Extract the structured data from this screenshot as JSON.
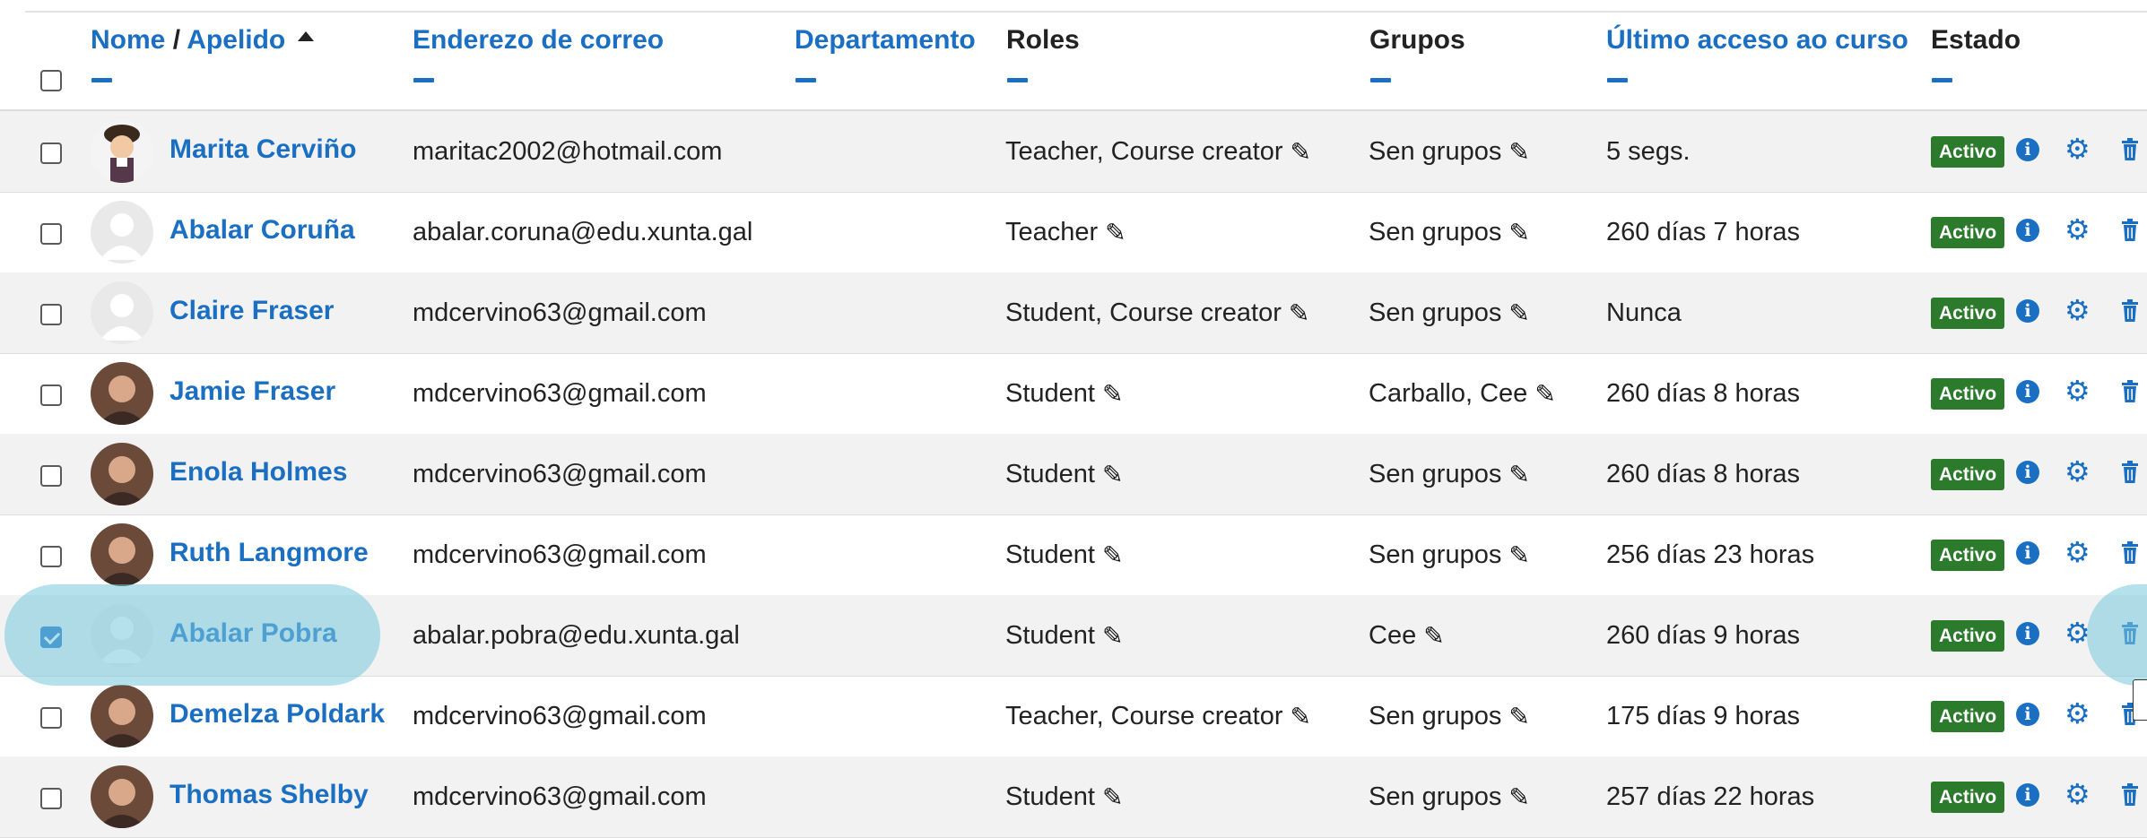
{
  "colors": {
    "link": "#1a6fc3",
    "badge": "#2c7a2c",
    "row_stripe": "#f2f2f2",
    "highlight": "#78c8dc"
  },
  "header": {
    "nome": "Nome",
    "separator": " / ",
    "apelido": "Apelido",
    "email": "Enderezo de correo",
    "departamento": "Departamento",
    "roles": "Roles",
    "grupos": "Grupos",
    "ultimo": "Último acceso ao curso",
    "estado": "Estado"
  },
  "rows": [
    {
      "name": "Marita Cerviño",
      "email": "maritac2002@hotmail.com",
      "roles": "Teacher, Course creator",
      "groups": "Sen grupos",
      "last": "5 segs.",
      "status": "Activo",
      "avatar": "cartoon-avatar",
      "checked": false
    },
    {
      "name": "Abalar Coruña",
      "email": "abalar.coruna@edu.xunta.gal",
      "roles": "Teacher",
      "groups": "Sen grupos",
      "last": "260 días 7 horas",
      "status": "Activo",
      "avatar": "default-avatar",
      "checked": false
    },
    {
      "name": "Claire Fraser",
      "email": "mdcervino63@gmail.com",
      "roles": "Student, Course creator",
      "groups": "Sen grupos",
      "last": "Nunca",
      "status": "Activo",
      "avatar": "default-avatar",
      "checked": false
    },
    {
      "name": "Jamie Fraser",
      "email": "mdcervino63@gmail.com",
      "roles": "Student",
      "groups": "Carballo, Cee",
      "last": "260 días 8 horas",
      "status": "Activo",
      "avatar": "photo-avatar",
      "checked": false
    },
    {
      "name": "Enola Holmes",
      "email": "mdcervino63@gmail.com",
      "roles": "Student",
      "groups": "Sen grupos",
      "last": "260 días 8 horas",
      "status": "Activo",
      "avatar": "photo-avatar",
      "checked": false
    },
    {
      "name": "Ruth Langmore",
      "email": "mdcervino63@gmail.com",
      "roles": "Student",
      "groups": "Sen grupos",
      "last": "256 días 23 horas",
      "status": "Activo",
      "avatar": "photo-avatar",
      "checked": false
    },
    {
      "name": "Abalar Pobra",
      "email": "abalar.pobra@edu.xunta.gal",
      "roles": "Student",
      "groups": "Cee",
      "last": "260 días 9 horas",
      "status": "Activo",
      "avatar": "default-avatar",
      "checked": true
    },
    {
      "name": "Demelza Poldark",
      "email": "mdcervino63@gmail.com",
      "roles": "Teacher, Course creator",
      "groups": "Sen grupos",
      "last": "175 días 9 horas",
      "status": "Activo",
      "avatar": "photo-avatar",
      "checked": false
    },
    {
      "name": "Thomas Shelby",
      "email": "mdcervino63@gmail.com",
      "roles": "Student",
      "groups": "Sen grupos",
      "last": "257 días 22 horas",
      "status": "Activo",
      "avatar": "photo-avatar",
      "checked": false
    }
  ]
}
